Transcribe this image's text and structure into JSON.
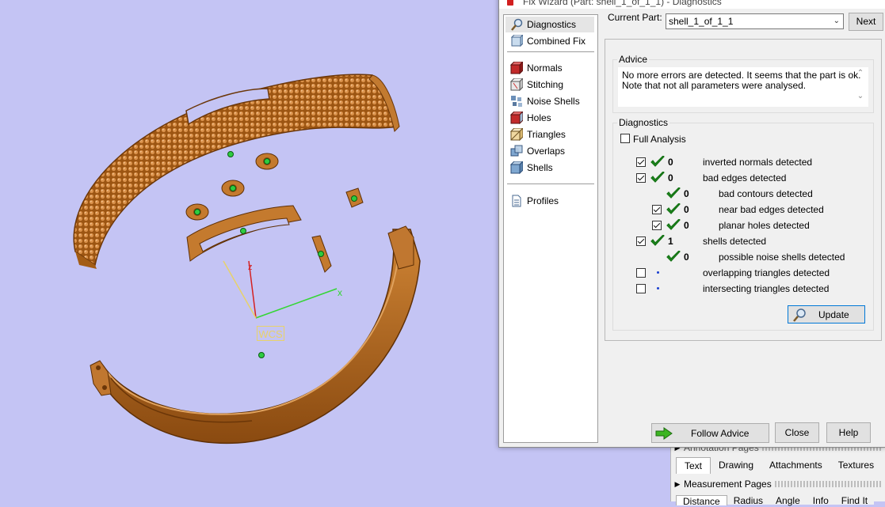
{
  "viewport": {
    "wcs_label": "WCS",
    "axis_x": "x",
    "axis_z": "z",
    "background": "#c4c4f4",
    "part_color": "#b8681a"
  },
  "host_panel": {
    "annotation_pages": "Annotation Pages",
    "tabs": [
      "Text",
      "Drawing",
      "Attachments",
      "Textures"
    ],
    "measurement_pages": "Measurement Pages",
    "bottom_tabs": [
      "Distance",
      "Radius",
      "Angle",
      "Info",
      "Find It"
    ]
  },
  "wizard": {
    "title": "Fix Wizard (Part: shell_1_of_1_1) - Diagnostics",
    "nav": {
      "items_top": [
        "Diagnostics",
        "Combined Fix"
      ],
      "items_mid": [
        "Normals",
        "Stitching",
        "Noise Shells",
        "Holes",
        "Triangles",
        "Overlaps",
        "Shells"
      ],
      "items_bottom": [
        "Profiles"
      ]
    },
    "current_part_label": "Current Part:",
    "current_part_value": "shell_1_of_1_1",
    "next_label": "Next",
    "advice": {
      "title": "Advice",
      "lines": [
        "No more errors are detected. It seems that the part is ok.",
        "Note that not all parameters were analysed."
      ]
    },
    "diagnostics": {
      "title": "Diagnostics",
      "full_analysis": "Full Analysis",
      "rows": [
        {
          "checked": true,
          "status": "ok",
          "count": "0",
          "label": "inverted normals detected"
        },
        {
          "checked": true,
          "status": "ok",
          "count": "0",
          "label": "bad edges detected"
        },
        {
          "checked": null,
          "status": "ok",
          "count": "0",
          "label": "bad contours detected"
        },
        {
          "checked": true,
          "status": "ok",
          "count": "0",
          "label": "near bad edges detected"
        },
        {
          "checked": true,
          "status": "ok",
          "count": "0",
          "label": "planar holes detected"
        },
        {
          "checked": true,
          "status": "ok",
          "count": "1",
          "label": "shells detected"
        },
        {
          "checked": null,
          "status": "ok",
          "count": "0",
          "label": "possible noise shells detected"
        },
        {
          "checked": false,
          "status": "pending",
          "count": "",
          "label": "overlapping triangles detected"
        },
        {
          "checked": false,
          "status": "pending",
          "count": "",
          "label": "intersecting triangles detected"
        }
      ],
      "update_label": "Update"
    },
    "follow_advice_label": "Follow Advice",
    "close_label": "Close",
    "help_label": "Help"
  }
}
